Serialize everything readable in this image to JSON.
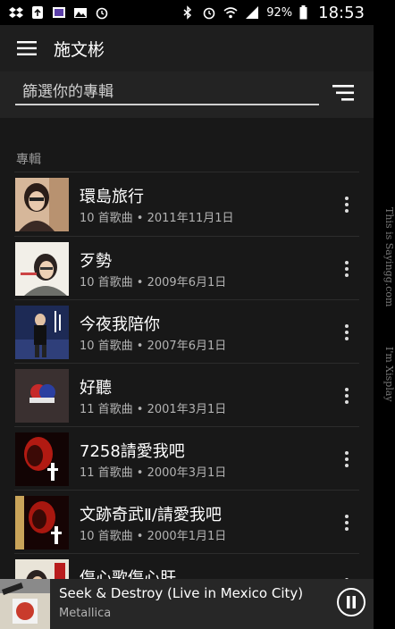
{
  "status_bar": {
    "left_icons": [
      "dropbox-icon",
      "recycle-icon",
      "image-icon",
      "gallery-icon",
      "alarm-icon"
    ],
    "right_icons": [
      "bluetooth-icon",
      "alarm-icon",
      "wifi-icon",
      "signal-icon"
    ],
    "battery": "92%",
    "time": "18:53"
  },
  "header": {
    "title": "施文彬"
  },
  "filter": {
    "placeholder": "篩選你的專輯",
    "value": ""
  },
  "section": {
    "title": "專輯"
  },
  "albums": [
    {
      "title": "環島旅行",
      "subtitle": "10 首歌曲 • 2011年11月1日"
    },
    {
      "title": "歹勢",
      "subtitle": "10 首歌曲 • 2009年6月1日"
    },
    {
      "title": "今夜我陪你",
      "subtitle": "10 首歌曲 • 2007年6月1日"
    },
    {
      "title": "好聽",
      "subtitle": "11 首歌曲 • 2001年3月1日"
    },
    {
      "title": "7258請愛我吧",
      "subtitle": "11 首歌曲 • 2000年3月1日"
    },
    {
      "title": "文跡奇武Ⅱ/請愛我吧",
      "subtitle": "10 首歌曲 • 2000年1月1日"
    },
    {
      "title": "傷心歌傷心肝",
      "subtitle": ""
    }
  ],
  "now_playing": {
    "title": "Seek & Destroy (Live in Mexico City)",
    "artist": "Metallica"
  },
  "watermark": {
    "line1": "This is Sayingg.com",
    "line2": "I'm Xisplay"
  },
  "colors": {
    "background": "#181818",
    "toolbar": "#1e1e1e",
    "accent": "#ffffff",
    "subtext": "#b3b3b3"
  }
}
